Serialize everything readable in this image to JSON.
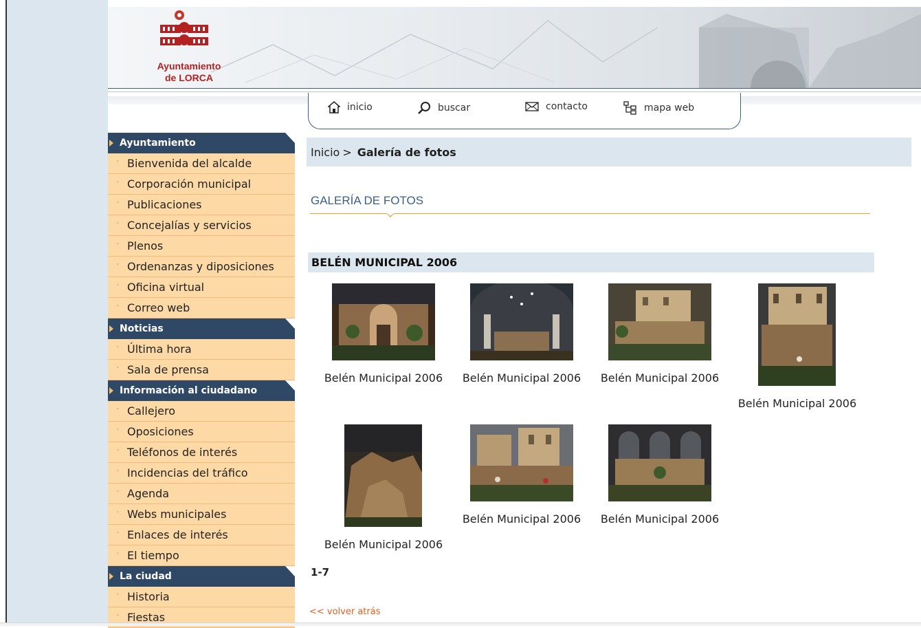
{
  "header": {
    "logo_line1": "Ayuntamiento",
    "logo_line2": "de LORCA"
  },
  "nav": {
    "items": [
      {
        "label": "inicio",
        "icon": "home-icon"
      },
      {
        "label": "buscar",
        "icon": "magnifier-icon"
      },
      {
        "label": "contacto",
        "icon": "envelope-icon"
      },
      {
        "label": "mapa web",
        "icon": "sitemap-icon"
      }
    ]
  },
  "sidebar": {
    "sections": [
      {
        "title": "Ayuntamiento",
        "items": [
          "Bienvenida del alcalde",
          "Corporación municipal",
          "Publicaciones",
          "Concejalías y servicios",
          "Plenos",
          "Ordenanzas y diposiciones",
          "Oficina virtual",
          "Correo web"
        ]
      },
      {
        "title": "Noticias",
        "items": [
          "Última hora",
          "Sala de prensa"
        ]
      },
      {
        "title": "Información al ciudadano",
        "items": [
          "Callejero",
          "Oposiciones",
          "Teléfonos de interés",
          "Incidencias del tráfico",
          "Agenda",
          "Webs municipales",
          "Enlaces de interés",
          "El tiempo"
        ]
      },
      {
        "title": "La ciudad",
        "items": [
          "Historia",
          "Fiestas"
        ]
      }
    ]
  },
  "breadcrumb": {
    "home": "Inicio",
    "separator": ">",
    "current": "Galería de fotos"
  },
  "page_title": "GALERÍA DE FOTOS",
  "album": {
    "title": "BELÉN MUNICIPAL 2006",
    "photos": [
      {
        "caption": "Belén Municipal 2006"
      },
      {
        "caption": "Belén Municipal 2006"
      },
      {
        "caption": "Belén Municipal 2006"
      },
      {
        "caption": "Belén Municipal 2006"
      },
      {
        "caption": "Belén Municipal 2006"
      },
      {
        "caption": "Belén Municipal 2006"
      },
      {
        "caption": "Belén Municipal 2006"
      }
    ]
  },
  "pager": "1-7",
  "back_link": "<< volver atrás",
  "colors": {
    "nav_blue": "#2f4866",
    "sidebar_item": "#fdd9a5",
    "title_blue": "#3a5f8a",
    "accent_orange": "#e8a13a",
    "link_orange": "#e06020"
  }
}
